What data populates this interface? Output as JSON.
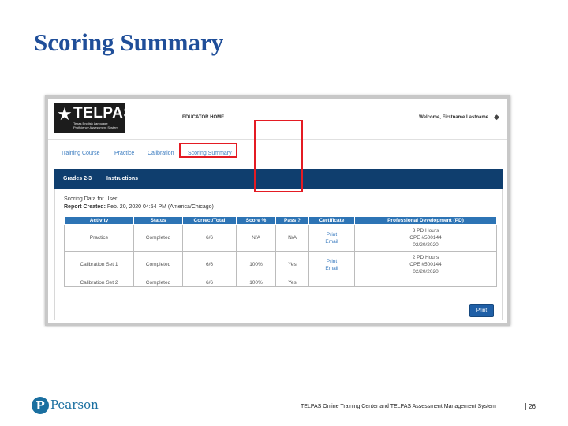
{
  "slide": {
    "title": "Scoring Summary",
    "footer_text": "TELPAS Online Training Center and TELPAS Assessment Management System",
    "page_number": "26",
    "brand": "Pearson",
    "brand_mark": "P"
  },
  "app": {
    "logo_word": "TELPAS",
    "logo_sub": "Texas English Language Proficiency Assessment System",
    "center_label": "EDUCATOR HOME",
    "welcome": "Welcome, Firstname Lastname",
    "tabs": [
      "Training Course",
      "Practice",
      "Calibration",
      "Scoring Summary"
    ],
    "active_tab": "Scoring Summary",
    "bar": {
      "grade": "Grades 2-3",
      "instructions": "Instructions"
    },
    "scoring_label": "Scoring Data for User",
    "report_label": "Report Created:",
    "report_value": "Feb. 20, 2020 04:54 PM (America/Chicago)",
    "table": {
      "headers": [
        "Activity",
        "Status",
        "Correct/Total",
        "Score %",
        "Pass ?",
        "Certificate",
        "Professional Development (PD)"
      ],
      "rows": [
        {
          "activity": "Practice",
          "status": "Completed",
          "correct": "6/6",
          "score": "N/A",
          "pass": "N/A",
          "cert_print": "Print",
          "cert_email": "Email",
          "pd1": "3 PD Hours",
          "pd2": "CPE #500144",
          "pd3": "02/20/2020"
        },
        {
          "activity": "Calibration Set 1",
          "status": "Completed",
          "correct": "6/6",
          "score": "100%",
          "pass": "Yes",
          "cert_print": "Print",
          "cert_email": "Email",
          "pd1": "2 PD Hours",
          "pd2": "CPE #500144",
          "pd3": "02/20/2020"
        },
        {
          "activity": "Calibration Set 2",
          "status": "Completed",
          "correct": "6/6",
          "score": "100%",
          "pass": "Yes",
          "cert_print": "",
          "cert_email": "",
          "pd1": "",
          "pd2": "",
          "pd3": ""
        }
      ]
    },
    "print_button": "Print"
  },
  "colors": {
    "title": "#1f4e99",
    "bar": "#0f3e6e",
    "table_header": "#2d74b5",
    "highlight": "#e41b23",
    "link": "#3a7bbf"
  }
}
